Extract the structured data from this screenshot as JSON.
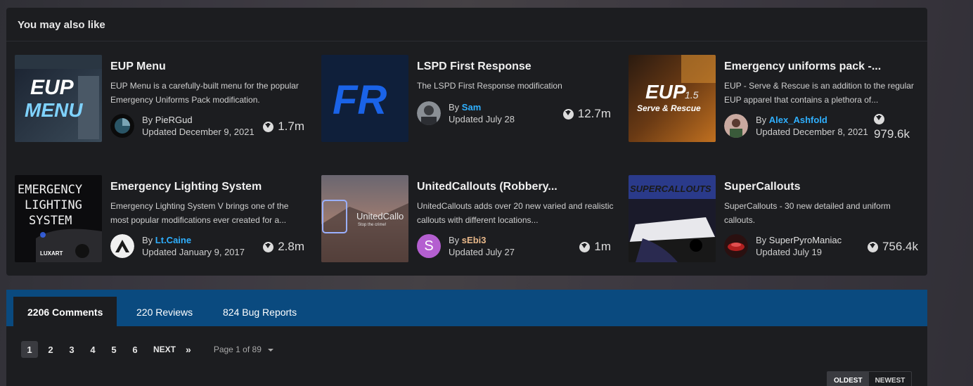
{
  "related": {
    "heading": "You may also like",
    "by_label": "By",
    "updated_prefix": "Updated",
    "items": [
      {
        "title": "EUP Menu",
        "description": "EUP Menu is a carefully-built menu for the popular Emergency Uniforms Pack modification.",
        "author": "PieRGud",
        "updated": "Updated December 9, 2021",
        "downloads": "1.7m",
        "thumb_text_1": "EUP",
        "thumb_text_2": "MENU"
      },
      {
        "title": "LSPD First Response",
        "description": "The LSPD First Response modification",
        "author": "Sam",
        "updated": "Updated July 28",
        "downloads": "12.7m",
        "thumb_text_1": "FR"
      },
      {
        "title": "Emergency uniforms pack -...",
        "description": "EUP - Serve & Rescue is an addition to the regular EUP apparel that contains a plethora of...",
        "author": "Alex_Ashfold",
        "updated": "Updated December 8, 2021",
        "downloads": "979.6k",
        "thumb_text_1": "EUP",
        "thumb_text_2": "1.5",
        "thumb_text_3": "Serve & Rescue"
      },
      {
        "title": "Emergency Lighting System",
        "description": "Emergency Lighting System V brings one of the most popular modifications ever created for a...",
        "author": "Lt.Caine",
        "updated": "Updated January 9, 2017",
        "downloads": "2.8m",
        "thumb_text_1": "EMERGENCY",
        "thumb_text_2": "LIGHTING",
        "thumb_text_3": "SYSTEM",
        "thumb_text_4": "LUXART"
      },
      {
        "title": "UnitedCallouts (Robbery...",
        "description": "UnitedCallouts adds over 20 new varied and realistic callouts with different locations...",
        "author": "sEbi3",
        "avatar_letter": "S",
        "updated": "Updated July 27",
        "downloads": "1m",
        "thumb_text_1": "UnitedCallo",
        "thumb_text_2": "Stop the crime!"
      },
      {
        "title": "SuperCallouts",
        "description": "SuperCallouts - 30 new detailed and uniform callouts.",
        "author": "SuperPyroManiac",
        "updated": "Updated July 19",
        "downloads": "756.4k",
        "thumb_text_1": "SUPERCALLOUTS"
      }
    ]
  },
  "tabs": [
    {
      "label": "2206 Comments",
      "active": true
    },
    {
      "label": "220 Reviews",
      "active": false
    },
    {
      "label": "824 Bug Reports",
      "active": false
    }
  ],
  "pagination": {
    "pages": [
      "1",
      "2",
      "3",
      "4",
      "5",
      "6"
    ],
    "current": "1",
    "next_label": "NEXT",
    "last_label": "»",
    "page_of": "Page 1 of 89"
  },
  "sort": {
    "oldest": "OLDEST",
    "newest": "NEWEST"
  },
  "colors": {
    "accent_blue": "#2fb0ff",
    "tab_bar": "#0a4a7f",
    "panel_bg": "#1c1d20"
  }
}
